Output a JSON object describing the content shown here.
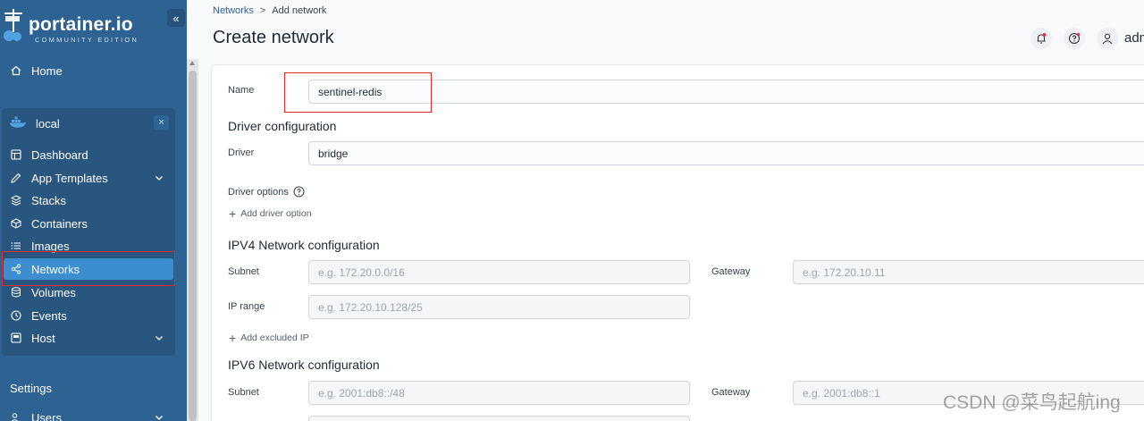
{
  "sidebar": {
    "logo_text": "portainer.io",
    "logo_sub": "COMMUNITY EDITION",
    "home_label": "Home",
    "environment": {
      "name": "local",
      "close_label": "×"
    },
    "items": [
      {
        "label": "Dashboard",
        "icon": "dashboard-icon"
      },
      {
        "label": "App Templates",
        "icon": "edit-icon",
        "expandable": true
      },
      {
        "label": "Stacks",
        "icon": "layers-icon"
      },
      {
        "label": "Containers",
        "icon": "box-icon"
      },
      {
        "label": "Images",
        "icon": "list-icon"
      },
      {
        "label": "Networks",
        "icon": "share-icon",
        "active": true
      },
      {
        "label": "Volumes",
        "icon": "database-icon"
      },
      {
        "label": "Events",
        "icon": "clock-icon"
      },
      {
        "label": "Host",
        "icon": "host-icon",
        "expandable": true
      }
    ],
    "settings_label": "Settings",
    "users_label": "Users"
  },
  "header": {
    "breadcrumb_root": "Networks",
    "breadcrumb_sep": ">",
    "breadcrumb_current": "Add network",
    "title": "Create network",
    "user": "adm"
  },
  "form": {
    "name_label": "Name",
    "name_value": "sentinel-redis",
    "driver_heading": "Driver configuration",
    "driver_label": "Driver",
    "driver_value": "bridge",
    "driver_options_label": "Driver options",
    "add_driver_option": "Add driver option",
    "ipv4_heading": "IPV4 Network configuration",
    "subnet_label": "Subnet",
    "ipv4_subnet_placeholder": "e.g. 172.20.0.0/16",
    "gateway_label": "Gateway",
    "ipv4_gateway_placeholder": "e.g. 172.20.10.11",
    "iprange_label": "IP range",
    "ipv4_iprange_placeholder": "e.g. 172.20.10.128/25",
    "add_excluded_ip": "Add excluded IP",
    "ipv6_heading": "IPV6 Network configuration",
    "ipv6_subnet_placeholder": "e.g. 2001:db8::/48",
    "ipv6_gateway_placeholder": "e.g. 2001:db8::1"
  },
  "watermark": "CSDN @菜鸟起航ing",
  "colors": {
    "sidebar": "#2e6292",
    "active": "#3c8ed0",
    "highlight": "#e02b2b"
  }
}
